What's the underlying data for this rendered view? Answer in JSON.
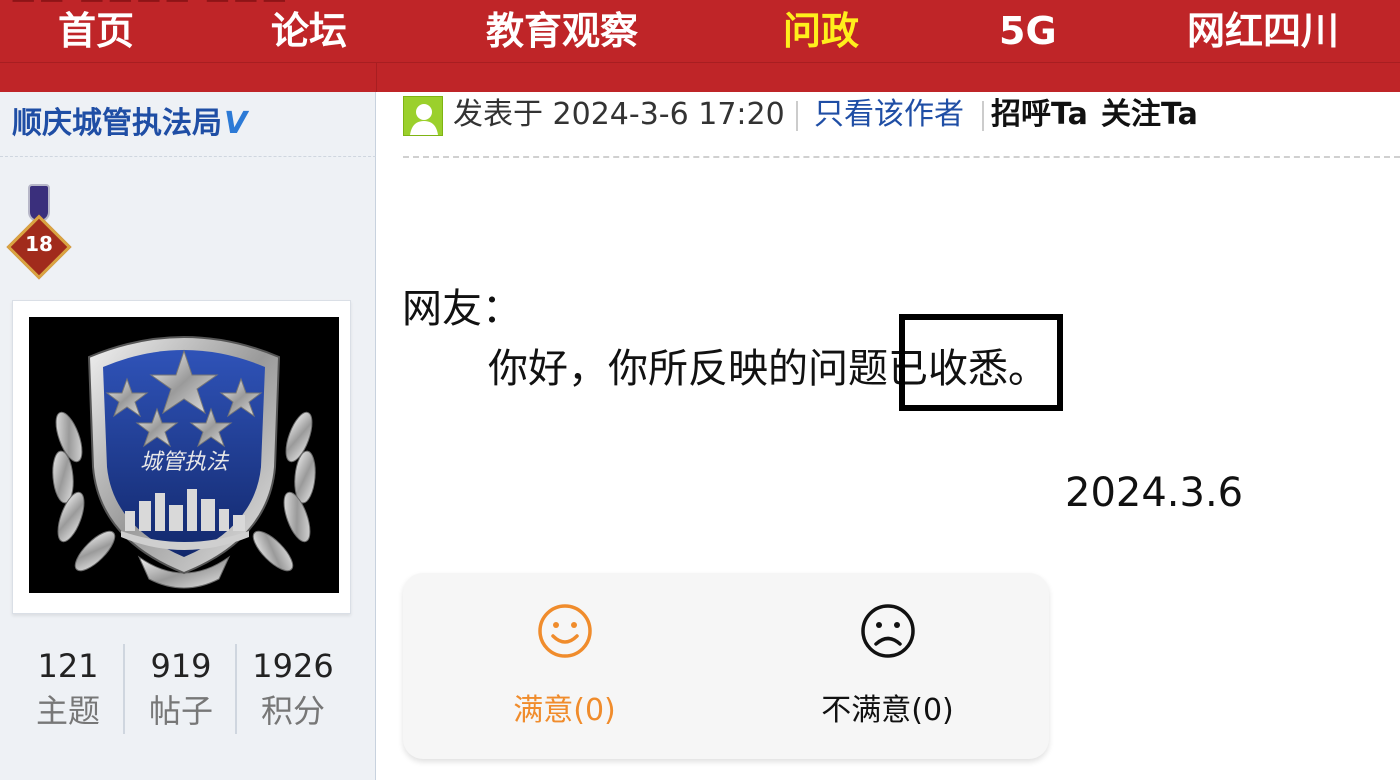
{
  "nav": {
    "items": [
      {
        "label": "首页",
        "active": false
      },
      {
        "label": "论坛",
        "active": false
      },
      {
        "label": "教育观察",
        "active": false
      },
      {
        "label": "问政",
        "active": true
      },
      {
        "label": "5G",
        "active": false
      },
      {
        "label": "网红四川",
        "active": false
      }
    ],
    "colors": {
      "bar": "#bf2528",
      "text": "#ffffff",
      "active": "#ffef1c"
    }
  },
  "author": {
    "name": "顺庆城管执法局",
    "verified_icon": "v-badge-icon",
    "medal_level": "18",
    "avatar_emblem_text": "城管执法",
    "stats": [
      {
        "value": "121",
        "label": "主题"
      },
      {
        "value": "919",
        "label": "帖子"
      },
      {
        "value": "1926",
        "label": "积分"
      }
    ]
  },
  "post": {
    "meta": {
      "posted_prefix": "发表于",
      "posted_time": "2024-3-6 17:20",
      "only_author": "只看该作者",
      "greet": "招呼Ta",
      "follow": "关注Ta"
    },
    "greeting": "网友：",
    "body": "你好，你所反映的问题已收悉。",
    "date": "2024.3.6"
  },
  "rating": {
    "satisfied": {
      "label": "满意(0)",
      "icon": "smile-icon",
      "color": "#f08c2c"
    },
    "unsatisfied": {
      "label": "不满意(0)",
      "icon": "frown-icon",
      "color": "#111111"
    }
  }
}
